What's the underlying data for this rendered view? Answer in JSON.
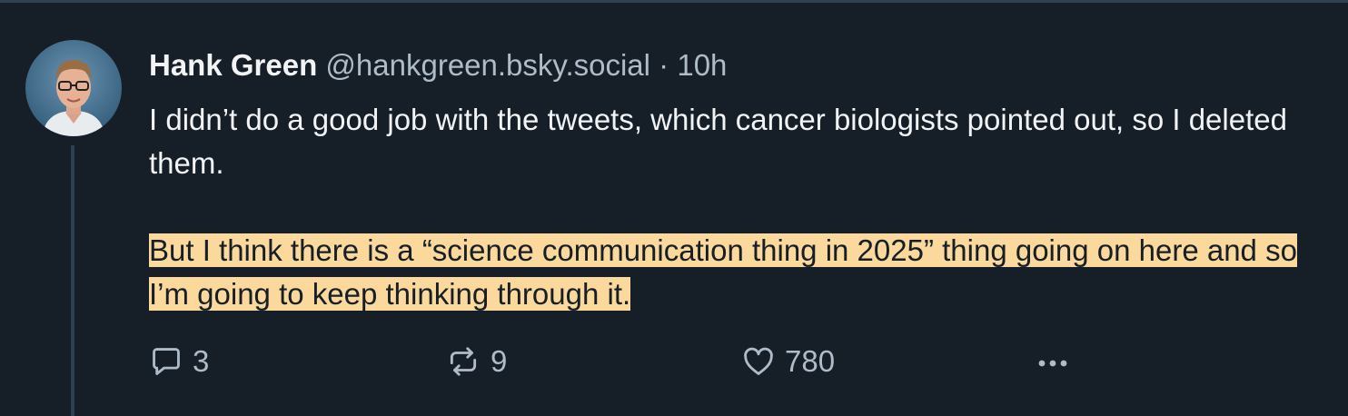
{
  "post": {
    "author_name": "Hank Green",
    "handle": "@hankgreen.bsky.social",
    "separator": "·",
    "timestamp": "10h",
    "paragraph_1": "I didn’t do a good job with the tweets, which cancer biologists pointed out, so I deleted them.",
    "paragraph_2": "But I think there is a “science communication thing in 2025” thing going on here and so I’m going to keep thinking through it.",
    "paragraph_2_highlighted": true
  },
  "actions": {
    "reply_count": "3",
    "repost_count": "9",
    "like_count": "780"
  },
  "icons": {
    "reply": "speech-bubble-icon",
    "repost": "repost-arrows-icon",
    "like": "heart-icon",
    "more": "more-dots-icon"
  },
  "colors": {
    "background": "#161e27",
    "text": "#f1f3f5",
    "muted": "#aebbc9",
    "highlight": "#fbd89b",
    "thread_line": "#2e4052"
  }
}
